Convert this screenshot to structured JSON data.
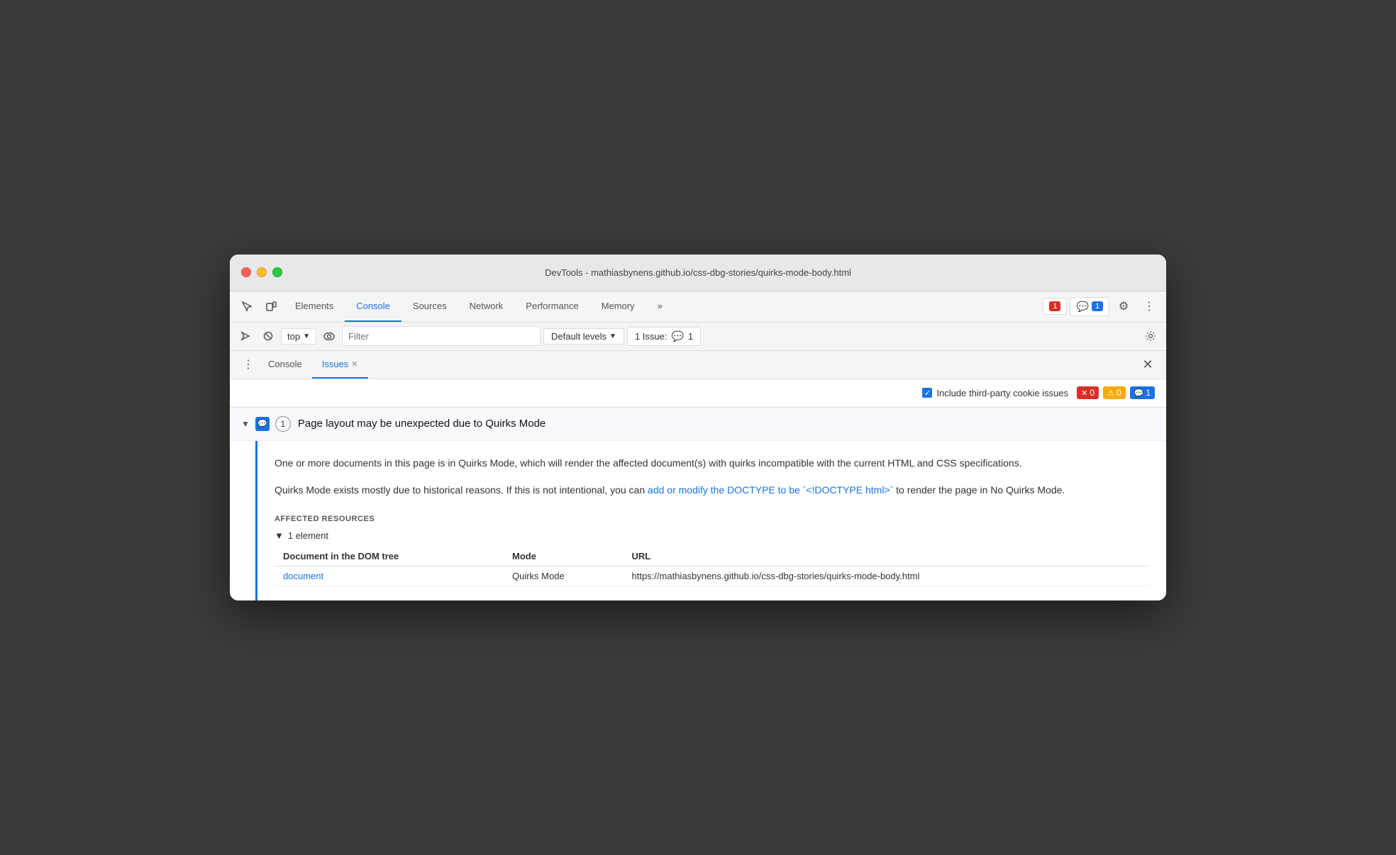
{
  "titlebar": {
    "title": "DevTools - mathiasbynens.github.io/css-dbg-stories/quirks-mode-body.html"
  },
  "tabs": {
    "items": [
      {
        "label": "Elements",
        "active": false
      },
      {
        "label": "Console",
        "active": true
      },
      {
        "label": "Sources",
        "active": false
      },
      {
        "label": "Network",
        "active": false
      },
      {
        "label": "Performance",
        "active": false
      },
      {
        "label": "Memory",
        "active": false
      }
    ],
    "more_label": "»"
  },
  "toolbar_right": {
    "error_count": "1",
    "info_count": "1",
    "gear_label": "⚙",
    "dots_label": "⋮"
  },
  "console_toolbar": {
    "run_icon": "▶",
    "block_icon": "⊘",
    "top_label": "top",
    "eye_icon": "👁",
    "filter_placeholder": "Filter",
    "levels_label": "Default levels",
    "issues_label": "1 Issue:",
    "issues_count": "1",
    "gear_icon": "⚙"
  },
  "panel_tabs": {
    "dots_icon": "⋮",
    "tabs": [
      {
        "label": "Console",
        "active": false,
        "closeable": false
      },
      {
        "label": "Issues",
        "active": true,
        "closeable": true
      }
    ],
    "close_icon": "✕"
  },
  "issues_toolbar": {
    "checkbox_label": "Include third-party cookie issues",
    "error_count": "0",
    "warning_count": "0",
    "info_count": "1"
  },
  "issue": {
    "title": "Page layout may be unexpected due to Quirks Mode",
    "count": "1",
    "desc1": "One or more documents in this page is in Quirks Mode, which will render the affected document(s) with quirks incompatible with the current HTML and CSS specifications.",
    "desc2_pre": "Quirks Mode exists mostly due to historical reasons. If this is not intentional, you can ",
    "desc2_link": "add or modify the DOCTYPE to be `<!DOCTYPE html>`",
    "desc2_post": " to render the page in No Quirks Mode.",
    "affected_label": "AFFECTED RESOURCES",
    "affected_count": "1 element",
    "col_document": "Document in the DOM tree",
    "col_mode": "Mode",
    "col_url": "URL",
    "doc_link": "document",
    "mode_value": "Quirks Mode",
    "url_value": "https://mathiasbynens.github.io/css-dbg-stories/quirks-mode-body.html"
  }
}
